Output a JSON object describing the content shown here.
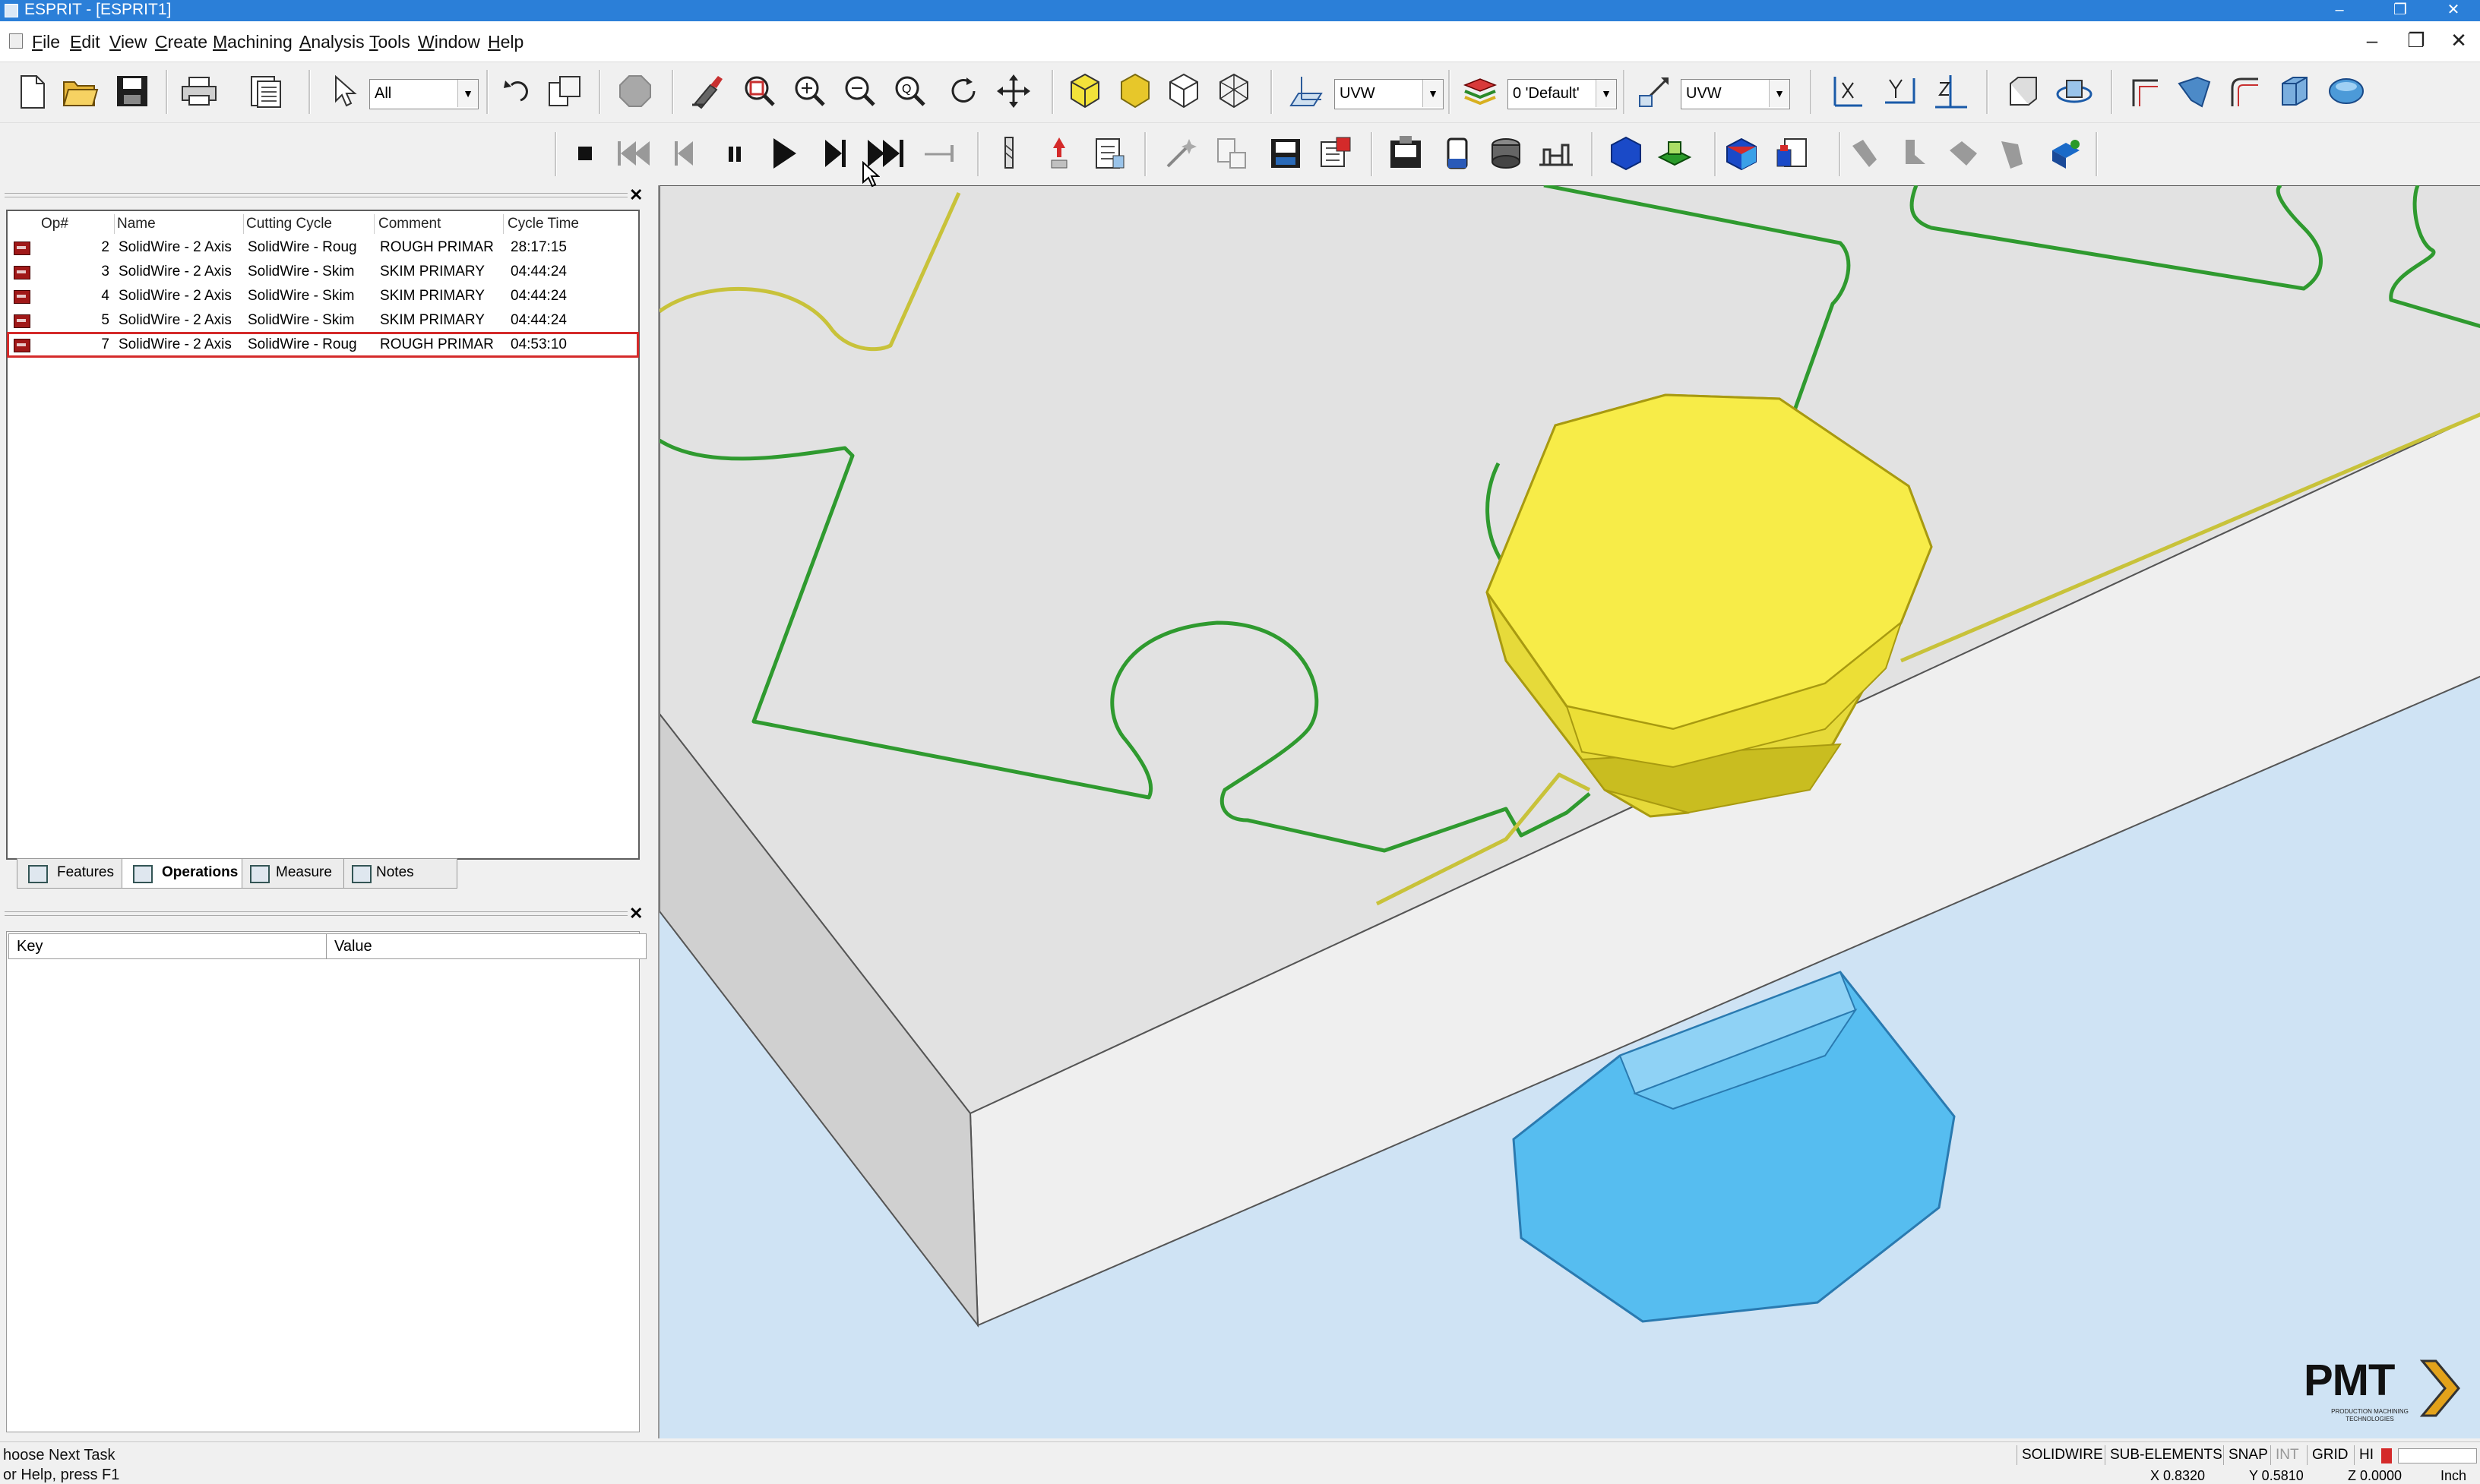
{
  "window": {
    "title": "ESPRIT - [ESPRIT1]"
  },
  "menu": [
    "File",
    "Edit",
    "View",
    "Create",
    "Machining",
    "Analysis",
    "Tools",
    "Window",
    "Help"
  ],
  "toolbar": {
    "filter_combo": "All",
    "plane_combo_1": "UVW",
    "layer_combo": "0 'Default'",
    "plane_combo_2": "UVW"
  },
  "operations": {
    "columns": [
      "Op#",
      "Name",
      "Cutting Cycle",
      "Comment",
      "Cycle Time"
    ],
    "rows": [
      {
        "op": "2",
        "name": "SolidWire - 2 Axis",
        "cycle": "SolidWire - Roug",
        "comment": "ROUGH PRIMAR",
        "time": "28:17:15"
      },
      {
        "op": "3",
        "name": "SolidWire - 2 Axis",
        "cycle": "SolidWire - Skim",
        "comment": "SKIM PRIMARY",
        "time": "04:44:24"
      },
      {
        "op": "4",
        "name": "SolidWire - 2 Axis",
        "cycle": "SolidWire - Skim",
        "comment": "SKIM PRIMARY",
        "time": "04:44:24"
      },
      {
        "op": "5",
        "name": "SolidWire - 2 Axis",
        "cycle": "SolidWire - Skim",
        "comment": "SKIM PRIMARY",
        "time": "04:44:24"
      },
      {
        "op": "7",
        "name": "SolidWire - 2 Axis",
        "cycle": "SolidWire - Roug",
        "comment": "ROUGH PRIMAR",
        "time": "04:53:10"
      }
    ],
    "selected_index": 4
  },
  "panel_tabs": [
    "Features",
    "Operations",
    "Measure",
    "Notes"
  ],
  "active_tab": "Operations",
  "properties": {
    "columns": [
      "Key",
      "Value"
    ]
  },
  "status": {
    "line1": "hoose Next Task",
    "line2": "or Help, press F1",
    "indicators": [
      "SOLIDWIRE",
      "SUB-ELEMENTS",
      "SNAP",
      "INT",
      "GRID",
      "HI"
    ],
    "x": "X 0.8320",
    "y": "Y 0.5810",
    "z": "Z 0.0000",
    "unit": "Inch"
  },
  "logo": {
    "text": "PMT",
    "tagline": "PRODUCTION MACHINING TECHNOLOGIES"
  },
  "colors": {
    "titlebar": "#2b7fd8",
    "upper_guide": "#f2e84a",
    "lower_guide": "#56bdf0",
    "path_green": "#2f9a2f",
    "path_yellow": "#c8c23a",
    "selection": "#d42a2a"
  }
}
